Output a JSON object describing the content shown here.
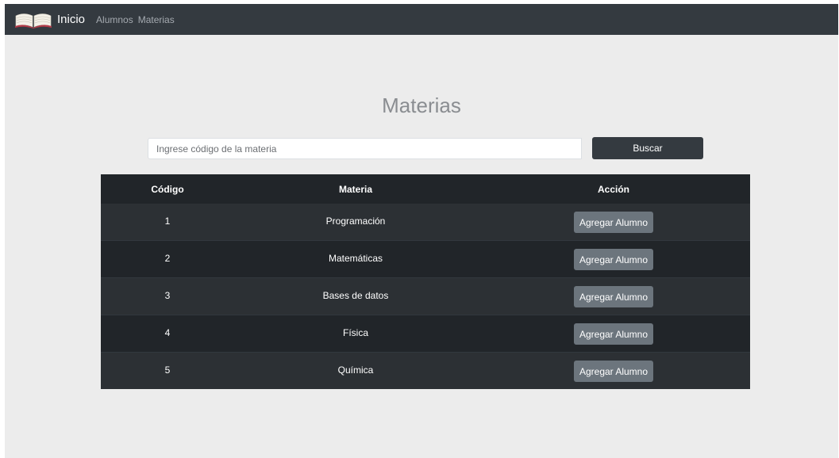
{
  "navbar": {
    "brand_label": "Inicio",
    "brand_icon": "open-book-icon",
    "links": [
      "Alumnos",
      "Materias"
    ]
  },
  "page": {
    "title": "Materias"
  },
  "search": {
    "placeholder": "Ingrese código de la materia",
    "value": "",
    "button_label": "Buscar"
  },
  "table": {
    "headers": [
      "Código",
      "Materia",
      "Acción"
    ],
    "rows": [
      {
        "codigo": "1",
        "materia": "Programación",
        "accion": "Agregar Alumno"
      },
      {
        "codigo": "2",
        "materia": "Matemáticas",
        "accion": "Agregar Alumno"
      },
      {
        "codigo": "3",
        "materia": "Bases de datos",
        "accion": "Agregar Alumno"
      },
      {
        "codigo": "4",
        "materia": "Física",
        "accion": "Agregar Alumno"
      },
      {
        "codigo": "5",
        "materia": "Química",
        "accion": "Agregar Alumno"
      }
    ]
  },
  "colors": {
    "navbar_bg": "#343a40",
    "page_bg": "#ececec",
    "table_header_bg": "#212529",
    "row_striped_bg": "#2c3034",
    "button_secondary": "#6c757d"
  }
}
